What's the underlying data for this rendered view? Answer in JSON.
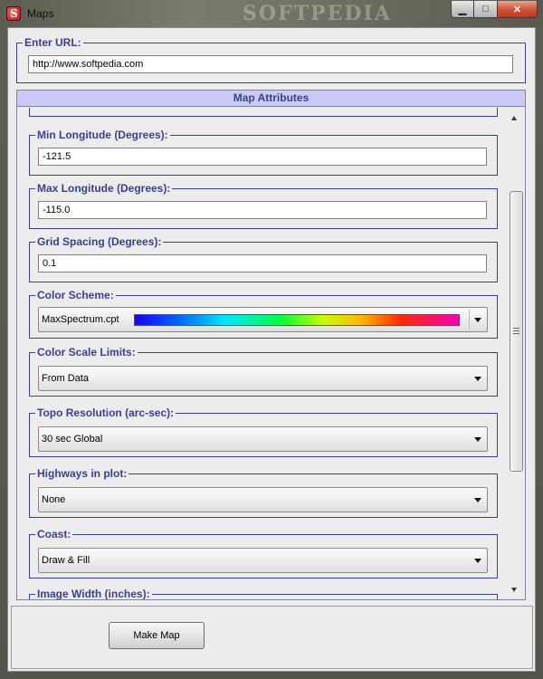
{
  "window": {
    "title": "Maps",
    "watermark": "SOFTPEDIA"
  },
  "url": {
    "label": "Enter URL:",
    "value": "http://www.softpedia.com"
  },
  "attributes": {
    "header": "Map Attributes",
    "min_longitude": {
      "label": "Min Longitude (Degrees):",
      "value": "-121.5"
    },
    "max_longitude": {
      "label": "Max Longitude (Degrees):",
      "value": "-115.0"
    },
    "grid_spacing": {
      "label": "Grid Spacing (Degrees):",
      "value": "0.1"
    },
    "color_scheme": {
      "label": "Color Scheme:",
      "value": "MaxSpectrum.cpt"
    },
    "color_scale_limits": {
      "label": "Color Scale Limits:",
      "value": "From Data"
    },
    "topo_resolution": {
      "label": "Topo Resolution (arc-sec):",
      "value": "30 sec Global"
    },
    "highways": {
      "label": "Highways in plot:",
      "value": "None"
    },
    "coast": {
      "label": "Coast:",
      "value": "Draw & Fill"
    },
    "image_width": {
      "label": "Image Width (inches):"
    }
  },
  "actions": {
    "make_map": "Make Map"
  },
  "colors": {
    "accent": "#3b3f8f",
    "header_bg": "#c9caf6",
    "client_bg": "#ececec"
  },
  "icons": {
    "app": "softpedia-logo-icon",
    "minimize": "minimize-icon",
    "maximize": "maximize-icon",
    "close": "close-icon"
  }
}
